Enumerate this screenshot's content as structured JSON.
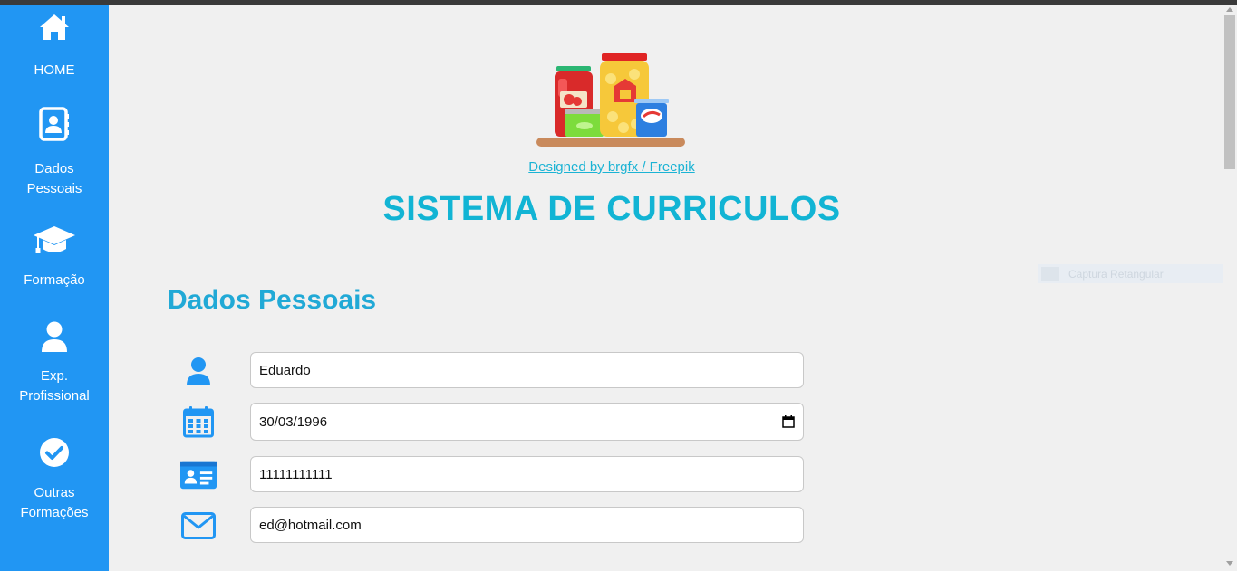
{
  "sidebar": {
    "items": [
      {
        "icon": "home-icon",
        "lines": [
          "HOME"
        ]
      },
      {
        "icon": "address-book-icon",
        "lines": [
          "Dados",
          "Pessoais"
        ]
      },
      {
        "icon": "graduation-cap-icon",
        "lines": [
          "Formação"
        ]
      },
      {
        "icon": "user-icon",
        "lines": [
          "Exp.",
          "Profissional"
        ]
      },
      {
        "icon": "check-circle-icon",
        "lines": [
          "Outras",
          "Formações"
        ]
      }
    ]
  },
  "hero": {
    "credit": "Designed by brgfx / Freepik"
  },
  "page": {
    "title": "SISTEMA DE CURRICULOS"
  },
  "section": {
    "title": "Dados Pessoais"
  },
  "form": {
    "name": {
      "icon": "user-icon",
      "value": "Eduardo"
    },
    "birthdate": {
      "icon": "calendar-icon",
      "value": "30/03/1996"
    },
    "document": {
      "icon": "id-card-icon",
      "value": "11111111111"
    },
    "email": {
      "icon": "envelope-icon",
      "value": "ed@hotmail.com"
    }
  },
  "overlay": {
    "label": "Captura Retangular"
  },
  "colors": {
    "sidebar": "#2196f3",
    "accent": "#12b4d4",
    "icon": "#2196f3",
    "background": "#f0f0f0"
  }
}
